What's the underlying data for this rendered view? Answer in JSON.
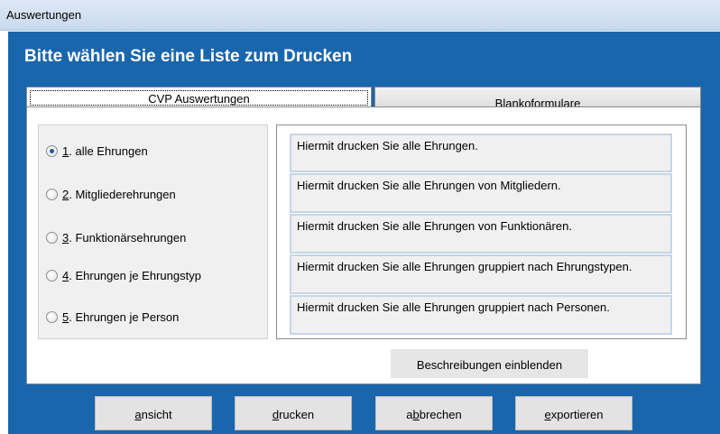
{
  "window": {
    "title": "Auswertungen"
  },
  "heading": "Bitte wählen Sie eine Liste zum Drucken",
  "tabs": [
    {
      "label": "CVP Auswertungen",
      "active": true
    },
    {
      "label": "Blankoformulare",
      "active": false
    }
  ],
  "options": [
    {
      "num": "1",
      "rest": ". alle Ehrungen",
      "checked": true
    },
    {
      "num": "2",
      "rest": ". Mitgliederehrungen",
      "checked": false
    },
    {
      "num": "3",
      "rest": ". Funktionärsehrungen",
      "checked": false
    },
    {
      "num": "4",
      "rest": ". Ehrungen je Ehrungstyp",
      "checked": false
    },
    {
      "num": "5",
      "rest": ". Ehrungen je Person",
      "checked": false
    }
  ],
  "descriptions": [
    "Hiermit drucken Sie alle Ehrungen.",
    "Hiermit drucken Sie alle Ehrungen von Mitgliedern.",
    "Hiermit drucken Sie alle Ehrungen von Funktionären.",
    "Hiermit drucken Sie alle Ehrungen gruppiert nach Ehrungstypen.",
    "Hiermit drucken Sie alle Ehrungen gruppiert nach Personen."
  ],
  "show_descriptions_button": "Beschreibungen einblenden",
  "footer_buttons": {
    "ansicht": {
      "pre": "",
      "u": "a",
      "post": "nsicht"
    },
    "drucken": {
      "pre": "",
      "u": "d",
      "post": "rucken"
    },
    "abbrechen": {
      "pre": "a",
      "u": "b",
      "post": "brechen"
    },
    "exportieren": {
      "pre": "",
      "u": "e",
      "post": "xportieren"
    }
  }
}
